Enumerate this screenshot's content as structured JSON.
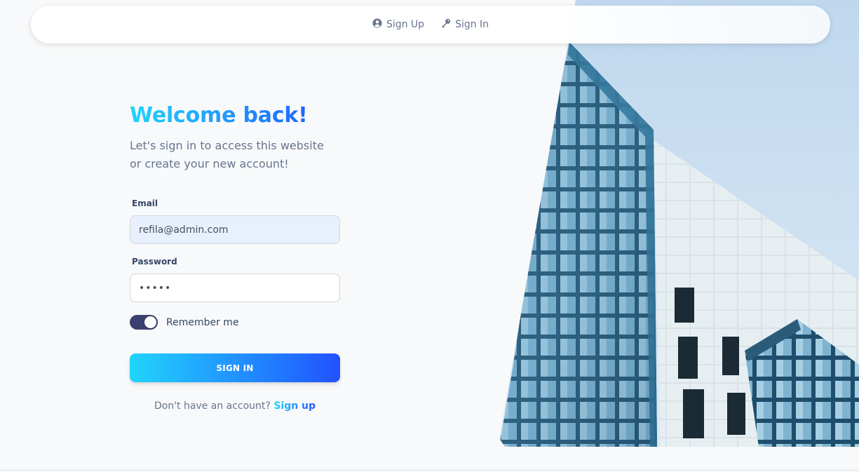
{
  "nav": {
    "signup": {
      "label": "Sign Up",
      "icon": "user-circle-icon"
    },
    "signin": {
      "label": "Sign In",
      "icon": "key-icon"
    }
  },
  "form": {
    "title": "Welcome back!",
    "subtitle": "Let's sign in to access this website\nor create your new account!",
    "email": {
      "label": "Email",
      "value": "refila@admin.com"
    },
    "password": {
      "label": "Password",
      "value": "•••••"
    },
    "remember": {
      "label": "Remember me",
      "checked": true
    },
    "submit_label": "SIGN IN",
    "no_account_text": "Don't have an account? ",
    "signup_link": "Sign up"
  },
  "colors": {
    "gradient_start": "#21d4fd",
    "gradient_end": "#2152ff",
    "toggle_on": "#3a416f",
    "text_muted": "#67748e",
    "text_dark": "#344767"
  },
  "hero": {
    "image": "office-building-photo"
  }
}
